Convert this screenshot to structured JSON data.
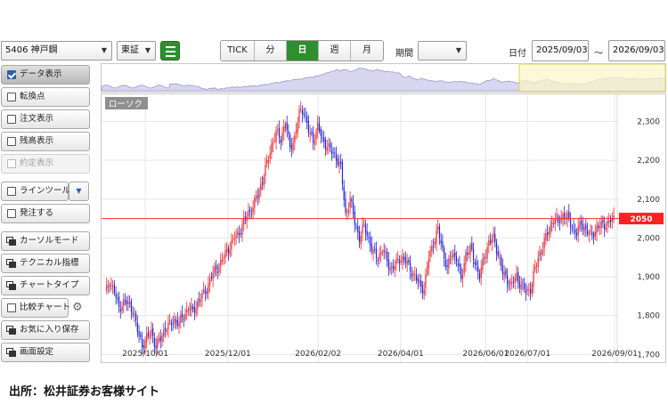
{
  "toolbar": {
    "symbol": "5406 神戸鋼",
    "market": "東証",
    "list_icon": "list-icon",
    "intervals": [
      {
        "label": "TICK",
        "active": false
      },
      {
        "label": "分",
        "active": false
      },
      {
        "label": "日",
        "active": true
      },
      {
        "label": "週",
        "active": false
      },
      {
        "label": "月",
        "active": false
      }
    ],
    "period_label": "期間",
    "period_value": "",
    "date_label": "日付",
    "date_from": "2025/09/03",
    "date_sep": "～",
    "date_to": "2026/09/03"
  },
  "left_panel": [
    {
      "label": "データ表示",
      "checked": true,
      "kind": "check",
      "state": "active"
    },
    {
      "label": "転換点",
      "checked": false,
      "kind": "check",
      "state": "normal"
    },
    {
      "label": "注文表示",
      "checked": false,
      "kind": "check",
      "state": "normal"
    },
    {
      "label": "残高表示",
      "checked": false,
      "kind": "check",
      "state": "normal"
    },
    {
      "label": "約定表示",
      "checked": false,
      "kind": "check",
      "state": "disabled"
    },
    {
      "label": "ラインツール",
      "checked": false,
      "kind": "check",
      "state": "normal",
      "extra": "dropdown"
    },
    {
      "label": "発注する",
      "checked": false,
      "kind": "check",
      "state": "normal"
    },
    {
      "label": "カーソルモード",
      "kind": "window",
      "state": "normal"
    },
    {
      "label": "テクニカル指標",
      "kind": "window",
      "state": "normal"
    },
    {
      "label": "チャートタイプ",
      "kind": "window",
      "state": "normal"
    },
    {
      "label": "比較チャート",
      "checked": false,
      "kind": "check",
      "state": "normal",
      "extra": "gear"
    },
    {
      "label": "お気に入り保存",
      "kind": "window",
      "state": "normal"
    },
    {
      "label": "画面設定",
      "kind": "window",
      "state": "normal"
    }
  ],
  "chart_data": {
    "type": "candlestick",
    "series_label": "ローソク",
    "x_tick_labels": [
      "2025/10/01",
      "2025/12/01",
      "2026/02/02",
      "2026/04/01",
      "2026/06/01",
      "2026/07/01",
      "2026/09/01"
    ],
    "y_tick_labels": [
      "2,300",
      "2,200",
      "2,100",
      "2,000",
      "1,900",
      "1,800",
      "1,700"
    ],
    "y_ticks": [
      2300,
      2200,
      2100,
      2000,
      1900,
      1800,
      1700
    ],
    "ylim": [
      1680,
      2370
    ],
    "price_line": {
      "value": 2050,
      "label": "2050",
      "color": "#ff2a2a"
    },
    "up_color": "#e8282b",
    "down_color": "#2424d8",
    "grid": true,
    "close_path": [
      [
        0,
        1855
      ],
      [
        3,
        1890
      ],
      [
        6,
        1860
      ],
      [
        9,
        1820
      ],
      [
        12,
        1835
      ],
      [
        15,
        1830
      ],
      [
        18,
        1815
      ],
      [
        21,
        1760
      ],
      [
        24,
        1725
      ],
      [
        27,
        1740
      ],
      [
        30,
        1760
      ],
      [
        33,
        1720
      ],
      [
        36,
        1740
      ],
      [
        39,
        1770
      ],
      [
        42,
        1775
      ],
      [
        45,
        1790
      ],
      [
        48,
        1780
      ],
      [
        51,
        1800
      ],
      [
        54,
        1820
      ],
      [
        57,
        1810
      ],
      [
        60,
        1835
      ],
      [
        63,
        1850
      ],
      [
        66,
        1870
      ],
      [
        69,
        1900
      ],
      [
        72,
        1920
      ],
      [
        75,
        1935
      ],
      [
        78,
        1960
      ],
      [
        81,
        1980
      ],
      [
        84,
        2000
      ],
      [
        87,
        2015
      ],
      [
        90,
        2040
      ],
      [
        93,
        2065
      ],
      [
        96,
        2080
      ],
      [
        99,
        2110
      ],
      [
        102,
        2150
      ],
      [
        105,
        2190
      ],
      [
        108,
        2240
      ],
      [
        111,
        2270
      ],
      [
        114,
        2255
      ],
      [
        117,
        2300
      ],
      [
        120,
        2230
      ],
      [
        123,
        2260
      ],
      [
        126,
        2320
      ],
      [
        129,
        2330
      ],
      [
        132,
        2275
      ],
      [
        135,
        2250
      ],
      [
        138,
        2290
      ],
      [
        141,
        2250
      ],
      [
        144,
        2240
      ],
      [
        147,
        2220
      ],
      [
        150,
        2210
      ],
      [
        153,
        2180
      ],
      [
        156,
        2060
      ],
      [
        159,
        2100
      ],
      [
        162,
        2040
      ],
      [
        165,
        2000
      ],
      [
        168,
        2030
      ],
      [
        171,
        2000
      ],
      [
        174,
        1960
      ],
      [
        177,
        1950
      ],
      [
        180,
        1970
      ],
      [
        183,
        1940
      ],
      [
        186,
        1920
      ],
      [
        189,
        1935
      ],
      [
        192,
        1950
      ],
      [
        195,
        1940
      ],
      [
        198,
        1920
      ],
      [
        201,
        1900
      ],
      [
        204,
        1880
      ],
      [
        207,
        1870
      ],
      [
        210,
        1950
      ],
      [
        213,
        1990
      ],
      [
        216,
        2020
      ],
      [
        219,
        1970
      ],
      [
        222,
        1920
      ],
      [
        225,
        1960
      ],
      [
        228,
        1950
      ],
      [
        231,
        1890
      ],
      [
        234,
        1960
      ],
      [
        237,
        1970
      ],
      [
        240,
        1940
      ],
      [
        243,
        1900
      ],
      [
        246,
        1950
      ],
      [
        249,
        1990
      ],
      [
        252,
        2000
      ],
      [
        255,
        1960
      ],
      [
        258,
        1910
      ],
      [
        261,
        1890
      ],
      [
        264,
        1880
      ],
      [
        267,
        1900
      ],
      [
        270,
        1880
      ],
      [
        273,
        1860
      ],
      [
        276,
        1870
      ],
      [
        279,
        1920
      ],
      [
        282,
        1960
      ],
      [
        285,
        1990
      ],
      [
        288,
        2020
      ],
      [
        291,
        2050
      ],
      [
        294,
        2040
      ],
      [
        297,
        2060
      ],
      [
        300,
        2050
      ],
      [
        303,
        2030
      ],
      [
        306,
        2010
      ],
      [
        309,
        2040
      ],
      [
        312,
        2020
      ],
      [
        315,
        2005
      ],
      [
        318,
        2020
      ],
      [
        321,
        2030
      ],
      [
        324,
        2035
      ],
      [
        327,
        2040
      ],
      [
        330,
        2050
      ]
    ]
  },
  "navigator": {
    "visible": true
  },
  "footer": "出所：松井証券お客様サイト"
}
